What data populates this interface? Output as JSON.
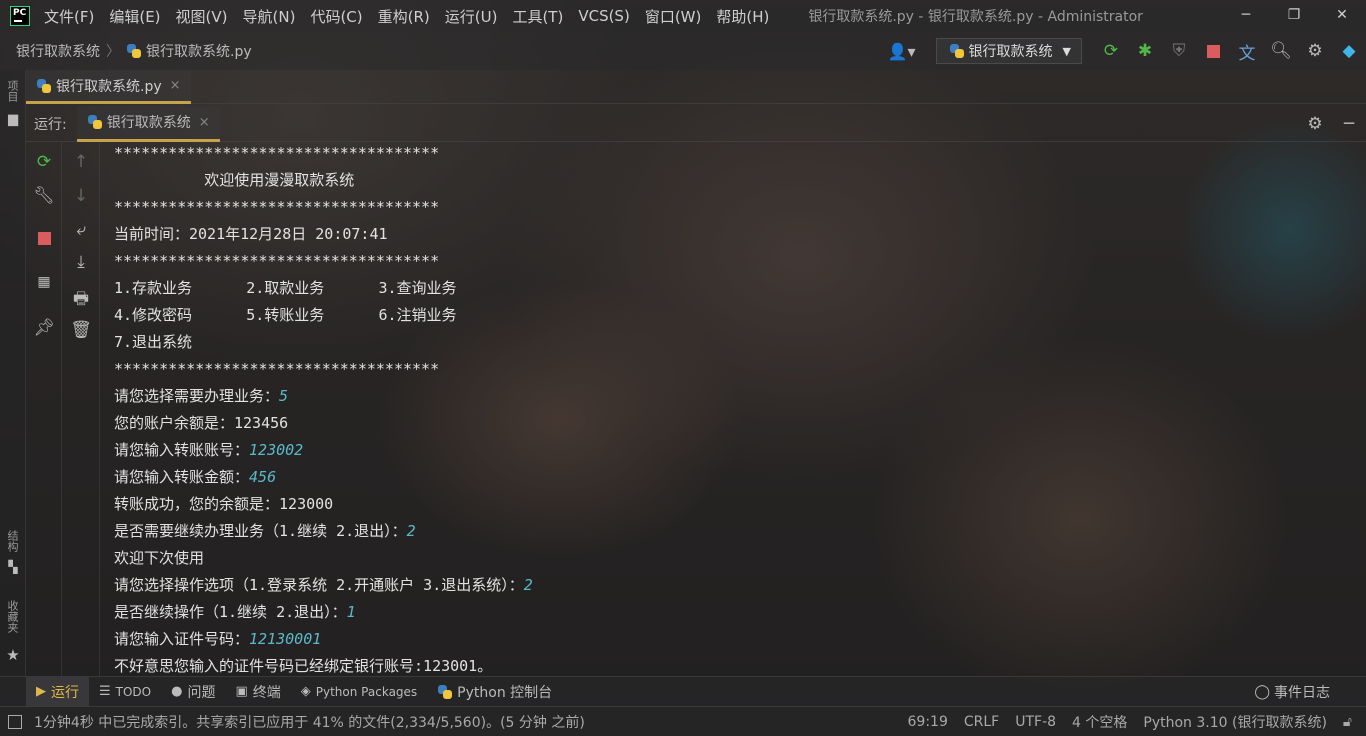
{
  "window": {
    "title": "银行取款系统.py - 银行取款系统.py - Administrator",
    "logo_text": "PC"
  },
  "menu": [
    "文件(F)",
    "编辑(E)",
    "视图(V)",
    "导航(N)",
    "代码(C)",
    "重构(R)",
    "运行(U)",
    "工具(T)",
    "VCS(S)",
    "窗口(W)",
    "帮助(H)"
  ],
  "window_controls": [
    "─",
    "❐",
    "✕"
  ],
  "breadcrumb": {
    "project": "银行取款系统",
    "file": "银行取款系统.py"
  },
  "toolbar": {
    "run_config": "银行取款系统",
    "icons": [
      "rerun-icon",
      "debug-icon",
      "coverage-icon",
      "stop-icon",
      "translate-icon",
      "search-icon",
      "settings-icon",
      "toolbox-icon"
    ]
  },
  "left_strip": {
    "project_label": "项目",
    "structure_label": "结构",
    "favorites_label": "收藏夹"
  },
  "editor_tab": {
    "label": "银行取款系统.py",
    "close": "×"
  },
  "run_panel": {
    "label": "运行:",
    "tab": "银行取款系统",
    "close": "×"
  },
  "console": {
    "lines": [
      {
        "text": "************************************",
        "input": ""
      },
      {
        "text": "          欢迎使用漫漫取款系统",
        "input": ""
      },
      {
        "text": "************************************",
        "input": ""
      },
      {
        "text": "当前时间：2021年12月28日 20:07:41",
        "input": ""
      },
      {
        "text": "************************************",
        "input": ""
      },
      {
        "text": "1.存款业务      2.取款业务      3.查询业务",
        "input": ""
      },
      {
        "text": "4.修改密码      5.转账业务      6.注销业务",
        "input": ""
      },
      {
        "text": "7.退出系统",
        "input": ""
      },
      {
        "text": "************************************",
        "input": ""
      },
      {
        "text": "请您选择需要办理业务：",
        "input": "5"
      },
      {
        "text": "您的账户余额是：123456",
        "input": ""
      },
      {
        "text": "请您输入转账账号：",
        "input": "123002"
      },
      {
        "text": "请您输入转账金额：",
        "input": "456"
      },
      {
        "text": "转账成功，您的余额是：123000",
        "input": ""
      },
      {
        "text": "是否需要继续办理业务（1.继续 2.退出）：",
        "input": "2"
      },
      {
        "text": "欢迎下次使用",
        "input": ""
      },
      {
        "text": "请您选择操作选项（1.登录系统 2.开通账户 3.退出系统）：",
        "input": "2"
      },
      {
        "text": "是否继续操作（1.继续 2.退出）：",
        "input": "1"
      },
      {
        "text": "请您输入证件号码：",
        "input": "12130001"
      },
      {
        "text": "不好意思您输入的证件号码已经绑定银行账号:123001。",
        "input": ""
      }
    ]
  },
  "bottom_tools": {
    "run": "运行",
    "todo": "TODO",
    "problems": "问题",
    "terminal": "终端",
    "packages": "Python Packages",
    "console": "Python 控制台",
    "event_log": "事件日志"
  },
  "status": {
    "message": "1分钟4秒 中已完成索引。共享索引已应用于 41% 的文件(2,334/5,560)。(5 分钟 之前)",
    "position": "69:19",
    "line_sep": "CRLF",
    "encoding": "UTF-8",
    "indent": "4 个空格",
    "interpreter": "Python 3.10 (银行取款系统)"
  },
  "colors": {
    "accent_tab": "#c6a24a",
    "input_text": "#5ab9c9",
    "run_green": "#4fb848",
    "stop_red": "#db5c5c"
  }
}
